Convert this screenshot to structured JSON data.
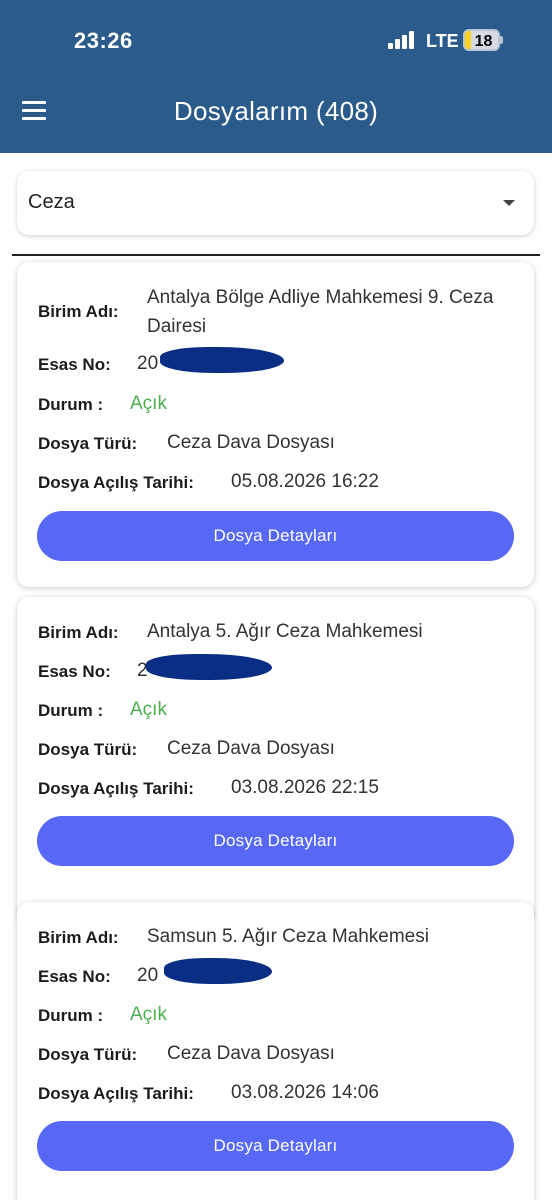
{
  "status_bar": {
    "time": "23:26",
    "network": "LTE",
    "battery": "18",
    "battery_level": 0.18
  },
  "header": {
    "title": "Dosyalarım (408)"
  },
  "filter": {
    "selected": "Ceza"
  },
  "labels": {
    "unit": "Birim Adı:",
    "case_no": "Esas No:",
    "status": "Durum :",
    "file_type": "Dosya Türü:",
    "open_date": "Dosya Açılış Tarihi:",
    "details_button": "Dosya Detayları"
  },
  "cases": [
    {
      "unit": "Antalya Bölge Adliye Mahkemesi 9. Ceza Dairesi",
      "case_no": "20",
      "status": "Açık",
      "file_type": "Ceza Dava Dosyası",
      "open_date": "05.08.2026 16:22"
    },
    {
      "unit": "Antalya 5. Ağır Ceza Mahkemesi",
      "case_no": "2",
      "status": "Açık",
      "file_type": "Ceza Dava Dosyası",
      "open_date": "03.08.2026 22:15"
    },
    {
      "unit": "Samsun 5. Ağır Ceza Mahkemesi",
      "case_no": "20",
      "status": "Açık",
      "file_type": "Ceza Dava Dosyası",
      "open_date": "03.08.2026 14:06"
    }
  ],
  "colors": {
    "header": "#2a5b8a",
    "button": "#5668f5",
    "status_open": "#4caf50",
    "redaction": "#0b2e85"
  },
  "icons": [
    "menu-icon",
    "signal-icon",
    "battery-icon",
    "chevron-down-icon"
  ]
}
